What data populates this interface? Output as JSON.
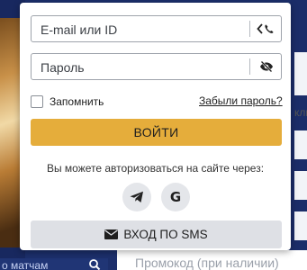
{
  "login": {
    "email_placeholder": "E-mail или ID",
    "password_placeholder": "Пароль",
    "remember_label": "Запомнить",
    "forgot_link": "Забыли пароль?",
    "login_button": "ВОЙТИ",
    "social_prompt": "Вы можете авторизоваться на сайте через:",
    "social_icons": [
      "telegram-icon",
      "google-icon"
    ],
    "google_letter": "G",
    "sms_button": "ВХОД ПО SMS"
  },
  "background": {
    "search_placeholder": "о матчам",
    "right_text": "кли",
    "promo_placeholder": "Промокод (при наличии)"
  },
  "colors": {
    "accent": "#e5ad3b",
    "page_bg": "#1c2f6b",
    "secondary_button": "#dee0e5"
  }
}
